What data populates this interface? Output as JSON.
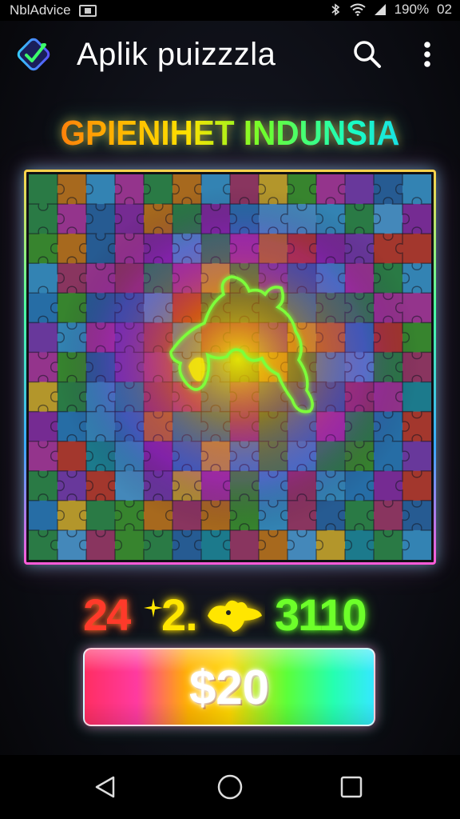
{
  "status_bar": {
    "carrier": "NblAdvice",
    "battery_percent": "190%",
    "time": "02"
  },
  "app_bar": {
    "title": "Aplik puizzzla",
    "logo_icon": "puzzle-check-icon",
    "search_icon": "search-icon",
    "menu_icon": "more-vert-icon"
  },
  "puzzle": {
    "title": "GPIENIHET INDUNSIA",
    "grid_cols": 14,
    "grid_rows": 13,
    "highlight_color": "#7dff3a"
  },
  "scores": {
    "left": "24",
    "middle": "2.",
    "right": "3110"
  },
  "buy_button": {
    "label": "$20"
  },
  "colors": {
    "accent_orange": "#ff5a14",
    "accent_yellow": "#ffe100",
    "accent_green": "#6dff2e",
    "accent_cyan": "#19c8ff",
    "accent_magenta": "#ff3aa0"
  },
  "nav_bar": {
    "back_icon": "back-triangle-icon",
    "home_icon": "home-circle-icon",
    "recents_icon": "recents-square-icon"
  }
}
